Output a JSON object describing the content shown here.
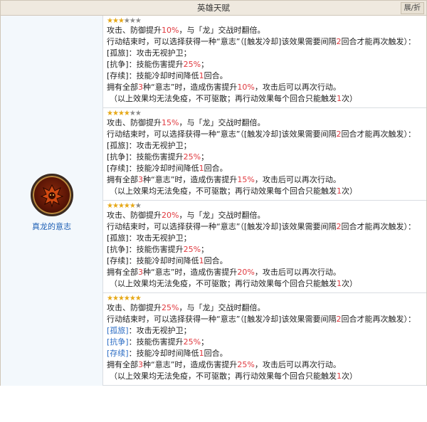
{
  "header": {
    "title": "英雄天赋",
    "toggle_label": "展/折"
  },
  "talent": {
    "name": "真龙的意志"
  },
  "tiers": [
    {
      "stars_on": 3,
      "stars_total": 6,
      "line1": {
        "a": "攻击、防御提升",
        "pct": "10%",
        "b": "，与「龙」交战时翻倍。"
      },
      "line2": {
        "a": "行动结束时，可以选择获得一种“意志”（[触发冷却]该效果需要间隔",
        "n": "2",
        "b": "回合才能再次触发）："
      },
      "opt1": {
        "tag": "[孤旅]",
        "text": "：攻击无视护卫；"
      },
      "opt2": {
        "tag": "[抗争]",
        "text": "：技能伤害提升",
        "pct": "25%",
        "end": "；"
      },
      "opt3": {
        "tag": "[存续]",
        "text": "：技能冷却时间降低",
        "n": "1",
        "end": "回合。"
      },
      "summary": {
        "a": "拥有全部",
        "n": "3",
        "b": "种“意志”时，造成伤害提升",
        "pct": "10%",
        "c": "，攻击后可以再次行动。"
      },
      "note": {
        "a": "（以上效果均无法免疫，不可驱散；再行动效果每个回合只能触发",
        "n": "1",
        "b": "次）"
      }
    },
    {
      "stars_on": 4,
      "stars_total": 6,
      "line1": {
        "a": "攻击、防御提升",
        "pct": "15%",
        "b": "，与「龙」交战时翻倍。"
      },
      "line2": {
        "a": "行动结束时，可以选择获得一种“意志”（[触发冷却]该效果需要间隔",
        "n": "2",
        "b": "回合才能再次触发）："
      },
      "opt1": {
        "tag": "[孤旅]",
        "text": "：攻击无视护卫；"
      },
      "opt2": {
        "tag": "[抗争]",
        "text": "：技能伤害提升",
        "pct": "25%",
        "end": "；"
      },
      "opt3": {
        "tag": "[存续]",
        "text": "：技能冷却时间降低",
        "n": "1",
        "end": "回合。"
      },
      "summary": {
        "a": "拥有全部",
        "n": "3",
        "b": "种“意志”时，造成伤害提升",
        "pct": "15%",
        "c": "，攻击后可以再次行动。"
      },
      "note": {
        "a": "（以上效果均无法免疫，不可驱散；再行动效果每个回合只能触发",
        "n": "1",
        "b": "次）"
      }
    },
    {
      "stars_on": 5,
      "stars_total": 6,
      "line1": {
        "a": "攻击、防御提升",
        "pct": "20%",
        "b": "，与「龙」交战时翻倍。"
      },
      "line2": {
        "a": "行动结束时，可以选择获得一种“意志”（[触发冷却]该效果需要间隔",
        "n": "2",
        "b": "回合才能再次触发）："
      },
      "opt1": {
        "tag": "[孤旅]",
        "text": "：攻击无视护卫；"
      },
      "opt2": {
        "tag": "[抗争]",
        "text": "：技能伤害提升",
        "pct": "25%",
        "end": "；"
      },
      "opt3": {
        "tag": "[存续]",
        "text": "：技能冷却时间降低",
        "n": "1",
        "end": "回合。"
      },
      "summary": {
        "a": "拥有全部",
        "n": "3",
        "b": "种“意志”时，造成伤害提升",
        "pct": "20%",
        "c": "，攻击后可以再次行动。"
      },
      "note": {
        "a": "（以上效果均无法免疫，不可驱散；再行动效果每个回合只能触发",
        "n": "1",
        "b": "次）"
      }
    },
    {
      "stars_on": 6,
      "stars_total": 6,
      "line1": {
        "a": "攻击、防御提升",
        "pct": "25%",
        "b": "，与「龙」交战时翻倍。"
      },
      "line2": {
        "a": "行动结束时，可以选择获得一种“意志”（[触发冷却]该效果需要间隔",
        "n": "2",
        "b": "回合才能再次触发）："
      },
      "opt1": {
        "tag": "[孤旅]",
        "text": "：攻击无视护卫；"
      },
      "opt2": {
        "tag": "[抗争]",
        "text": "：技能伤害提升",
        "pct": "25%",
        "end": "；"
      },
      "opt3": {
        "tag": "[存续]",
        "text": "：技能冷却时间降低",
        "n": "1",
        "end": "回合。"
      },
      "summary": {
        "a": "拥有全部",
        "n": "3",
        "b": "种“意志”时，造成伤害提升",
        "pct": "25%",
        "c": "，攻击后可以再次行动。"
      },
      "note": {
        "a": "（以上效果均无法免疫，不可驱散；再行动效果每个回合只能触发",
        "n": "1",
        "b": "次）"
      }
    }
  ]
}
